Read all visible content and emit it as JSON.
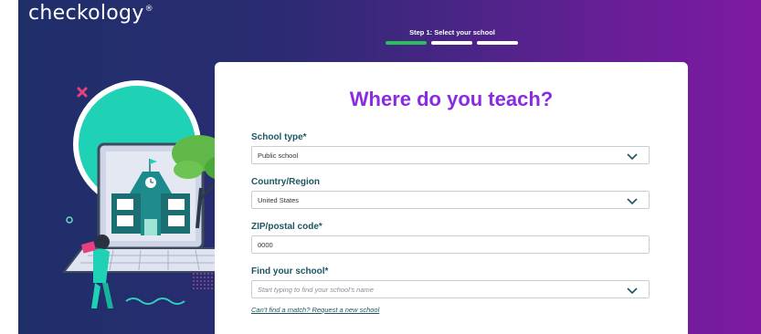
{
  "brand": {
    "logo_text": "checkology",
    "trademark": "®"
  },
  "progress": {
    "step_label": "Step 1: Select your school",
    "current_step": 1,
    "total_steps": 3,
    "active_color": "#2bbf5a"
  },
  "form": {
    "title": "Where do you teach?",
    "title_color": "#8a2be2",
    "school_type": {
      "label": "School type*",
      "value": "Public school"
    },
    "country": {
      "label": "Country/Region",
      "value": "United States"
    },
    "zip": {
      "label": "ZIP/postal code*",
      "value": "0000"
    },
    "school": {
      "label": "Find your school*",
      "placeholder": "Start typing to find your school's name",
      "value": ""
    },
    "request_link": "Can't find a match? Request a new school"
  },
  "icons": {
    "select_chevron": "chevron-down-icon",
    "illustration": "school-laptop-illustration"
  }
}
